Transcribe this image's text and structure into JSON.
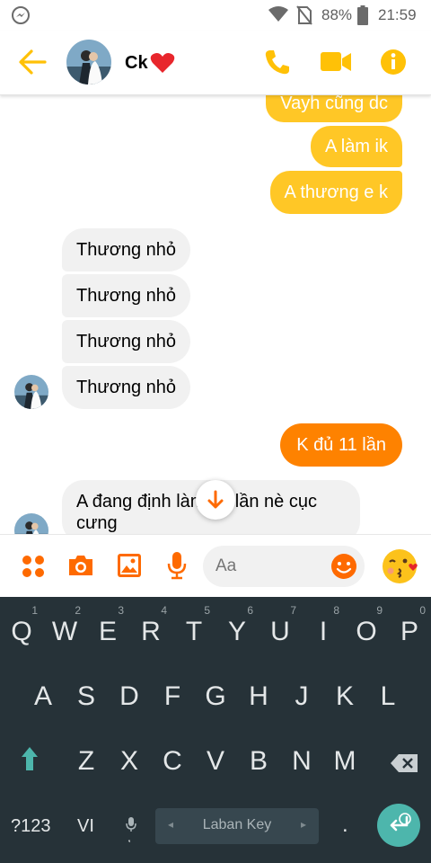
{
  "status_bar": {
    "battery": "88%",
    "time": "21:59"
  },
  "header": {
    "contact_name": "Ck"
  },
  "messages": {
    "outgoing": [
      "Vayh cũng dc",
      "A làm ik",
      "A thương e k"
    ],
    "incoming": [
      "Thương nhỏ",
      "Thương nhỏ",
      "Thương nhỏ",
      "Thương nhỏ"
    ],
    "outgoing_highlight": "K đủ 11 lần",
    "last_incoming_line1": "A đang định làm 19 lần nè cục",
    "last_incoming_line2": "cưng"
  },
  "composer": {
    "placeholder": "Aa"
  },
  "keyboard": {
    "row1": [
      {
        "k": "Q",
        "h": "1"
      },
      {
        "k": "W",
        "h": "2"
      },
      {
        "k": "E",
        "h": "3"
      },
      {
        "k": "R",
        "h": "4"
      },
      {
        "k": "T",
        "h": "5"
      },
      {
        "k": "Y",
        "h": "6"
      },
      {
        "k": "U",
        "h": "7"
      },
      {
        "k": "I",
        "h": "8"
      },
      {
        "k": "O",
        "h": "9"
      },
      {
        "k": "P",
        "h": "0"
      }
    ],
    "row2": [
      "A",
      "S",
      "D",
      "F",
      "G",
      "H",
      "J",
      "K",
      "L"
    ],
    "row3": [
      "Z",
      "X",
      "C",
      "V",
      "B",
      "N",
      "M"
    ],
    "symbols_key": "?123",
    "lang_key": "VI",
    "space_label": "Laban Key",
    "period_key": "."
  },
  "colors": {
    "accent": "#ffc726",
    "orange": "#fe8200",
    "keyboard_bg": "#263238",
    "enter": "#4db6ac"
  }
}
